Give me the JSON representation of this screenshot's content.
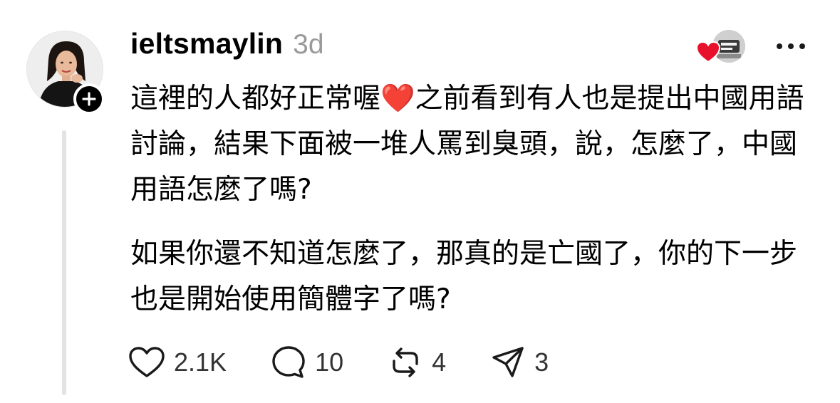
{
  "post": {
    "username": "ieltsmaylin",
    "timestamp": "3d",
    "paragraphs": [
      "這裡的人都好正常喔❤️之前看到有人也是提出中國用語討論，結果下面被一堆人罵到臭頭，說，怎麼了，中國用語怎麼了嗎?",
      "如果你還不知道怎麼了，那真的是亡國了，你的下一步也是開始使用簡體字了嗎?"
    ]
  },
  "actions": {
    "like_count": "2.1K",
    "reply_count": "10",
    "repost_count": "4",
    "share_count": "3"
  },
  "icons": {
    "follow": "plus-icon",
    "like": "heart-outline-icon",
    "reply": "speech-bubble-icon",
    "repost": "repost-arrows-icon",
    "share": "paper-plane-icon",
    "more": "ellipsis-icon",
    "liked_by": "red-heart-icon"
  },
  "colors": {
    "text": "#000000",
    "muted": "#9a9a9a",
    "thread_line": "#e3e3e3",
    "heart_red": "#e8112d"
  }
}
